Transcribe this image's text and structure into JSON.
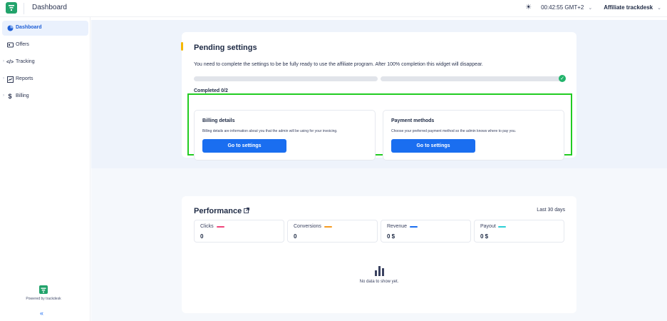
{
  "header": {
    "app_title": "Dashboard",
    "time": "00:42:55 GMT+2",
    "account": "Affiliate trackdesk",
    "brand_color": "#22a36b"
  },
  "sidebar": {
    "items": [
      {
        "label": "Dashboard",
        "icon": "dashboard-icon",
        "active": true
      },
      {
        "label": "Offers",
        "icon": "offers-icon"
      },
      {
        "label": "Tracking",
        "icon": "code-icon"
      },
      {
        "label": "Reports",
        "icon": "reports-icon"
      },
      {
        "label": "Billing",
        "icon": "dollar-icon"
      }
    ],
    "powered_by": "Powered by trackdesk",
    "collapse_icon": "double-chevron-left-icon"
  },
  "pending": {
    "title": "Pending settings",
    "description": "You need to complete the settings to be be fully ready to use the affiliate program. After 100% completion this widget will disappear.",
    "completed": "Completed 0/2",
    "progress": 0,
    "billing": {
      "title": "Billing details",
      "description": "Billing details are information about you that the admin will be using for your invoicing.",
      "button": "Go to settings"
    },
    "payment": {
      "title": "Payment methods",
      "description": "Choose your preferred payment method so the admin knows where to pay you.",
      "button": "Go to settings"
    }
  },
  "performance": {
    "title": "Performance",
    "range": "Last 30 days",
    "metrics": [
      {
        "label": "Clicks",
        "value": "0",
        "color": "#f0457a"
      },
      {
        "label": "Conversions",
        "value": "0",
        "color": "#f59a1f"
      },
      {
        "label": "Revenue",
        "value": "0 $",
        "color": "#1a6ef0"
      },
      {
        "label": "Payout",
        "value": "0 $",
        "color": "#2ccfd6"
      }
    ],
    "empty_text": "No data to show yet."
  }
}
